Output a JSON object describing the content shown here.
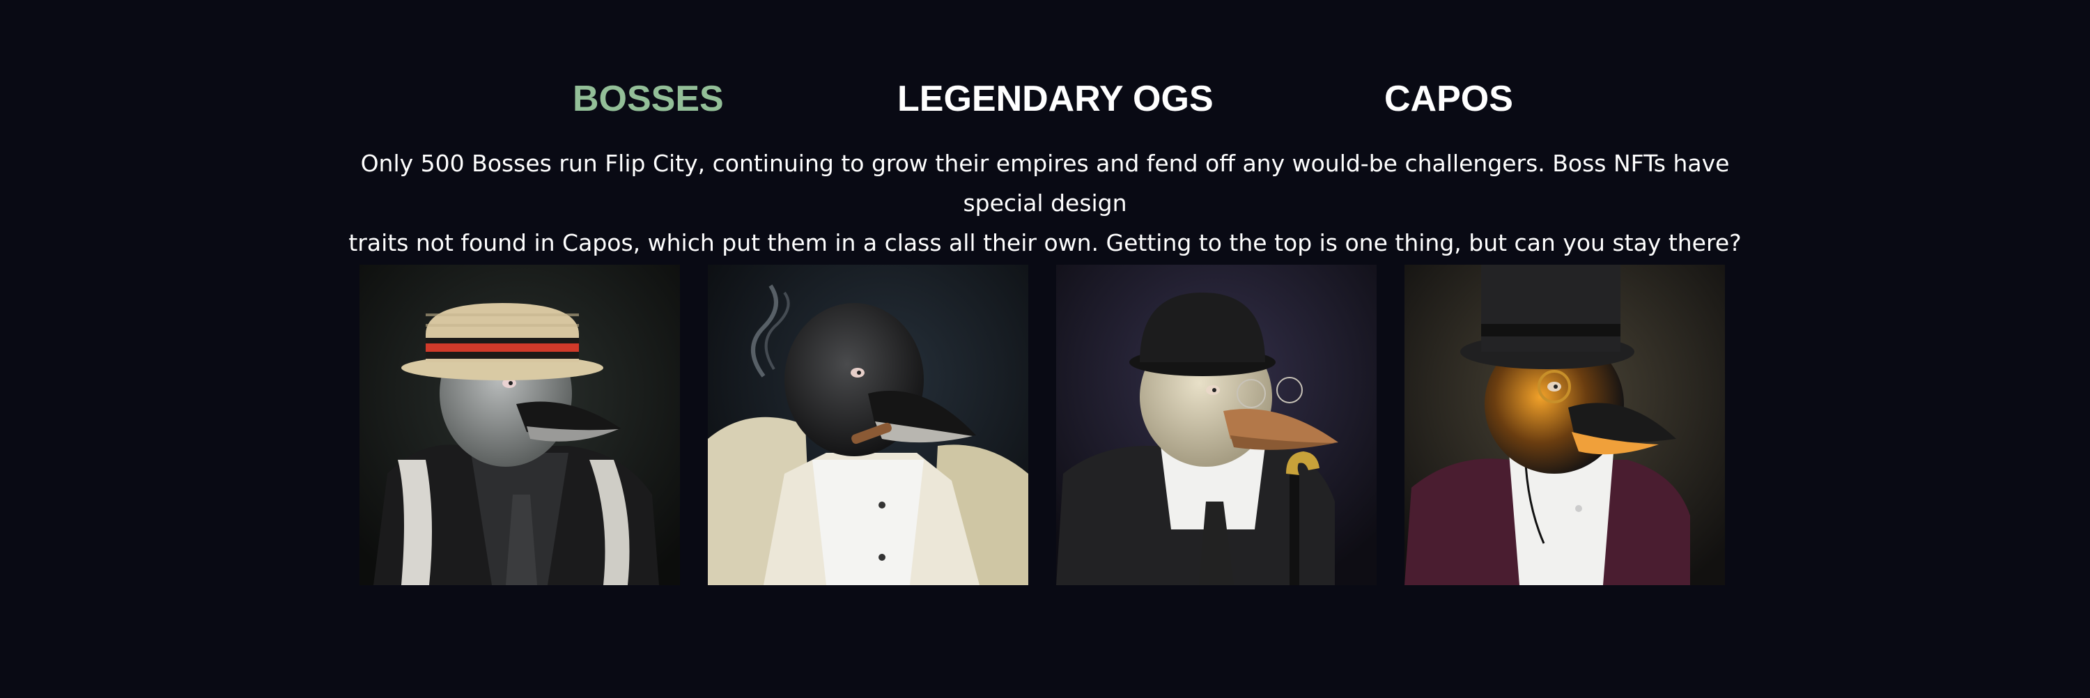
{
  "tabs": [
    {
      "label": "BOSSES",
      "active": true
    },
    {
      "label": "LEGENDARY OGS",
      "active": false
    },
    {
      "label": "CAPOS",
      "active": false
    }
  ],
  "description": {
    "line1": "Only 500 Bosses run Flip City, continuing to grow their empires and fend off any would-be challengers. Boss NFTs have special design",
    "line2": "traits not found in Capos, which put them in a class all their own. Getting to the top is one thing, but can you stay there?"
  },
  "colors": {
    "background": "#090a14",
    "active_tab": "#93bf98",
    "text": "#ffffff"
  },
  "gallery": {
    "items": [
      {
        "subject": "penguin-boss-boater-hat"
      },
      {
        "subject": "penguin-boss-cigar-fur-coat"
      },
      {
        "subject": "penguin-boss-bowler-cane"
      },
      {
        "subject": "penguin-boss-top-hat-monocle"
      }
    ]
  }
}
